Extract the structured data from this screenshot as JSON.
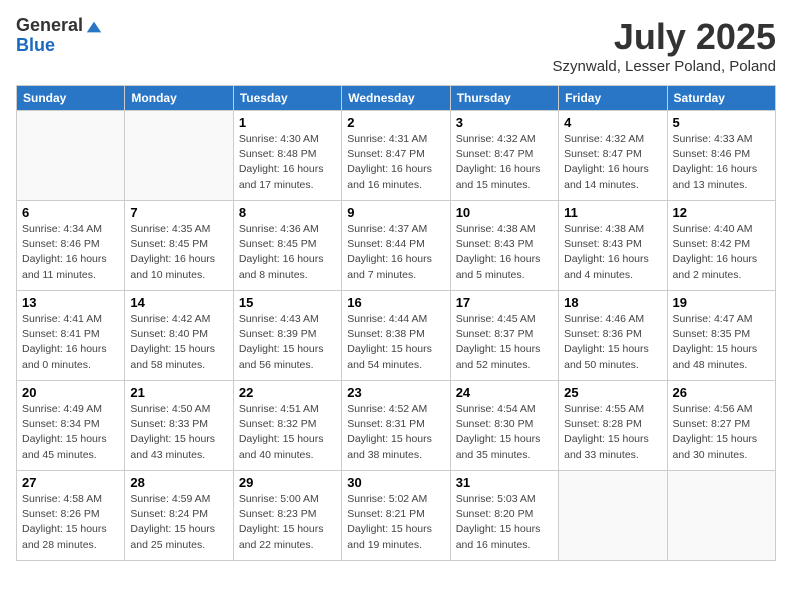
{
  "logo": {
    "general": "General",
    "blue": "Blue"
  },
  "title": "July 2025",
  "location": "Szynwald, Lesser Poland, Poland",
  "days_of_week": [
    "Sunday",
    "Monday",
    "Tuesday",
    "Wednesday",
    "Thursday",
    "Friday",
    "Saturday"
  ],
  "weeks": [
    [
      {
        "day": "",
        "info": ""
      },
      {
        "day": "",
        "info": ""
      },
      {
        "day": "1",
        "info": "Sunrise: 4:30 AM\nSunset: 8:48 PM\nDaylight: 16 hours and 17 minutes."
      },
      {
        "day": "2",
        "info": "Sunrise: 4:31 AM\nSunset: 8:47 PM\nDaylight: 16 hours and 16 minutes."
      },
      {
        "day": "3",
        "info": "Sunrise: 4:32 AM\nSunset: 8:47 PM\nDaylight: 16 hours and 15 minutes."
      },
      {
        "day": "4",
        "info": "Sunrise: 4:32 AM\nSunset: 8:47 PM\nDaylight: 16 hours and 14 minutes."
      },
      {
        "day": "5",
        "info": "Sunrise: 4:33 AM\nSunset: 8:46 PM\nDaylight: 16 hours and 13 minutes."
      }
    ],
    [
      {
        "day": "6",
        "info": "Sunrise: 4:34 AM\nSunset: 8:46 PM\nDaylight: 16 hours and 11 minutes."
      },
      {
        "day": "7",
        "info": "Sunrise: 4:35 AM\nSunset: 8:45 PM\nDaylight: 16 hours and 10 minutes."
      },
      {
        "day": "8",
        "info": "Sunrise: 4:36 AM\nSunset: 8:45 PM\nDaylight: 16 hours and 8 minutes."
      },
      {
        "day": "9",
        "info": "Sunrise: 4:37 AM\nSunset: 8:44 PM\nDaylight: 16 hours and 7 minutes."
      },
      {
        "day": "10",
        "info": "Sunrise: 4:38 AM\nSunset: 8:43 PM\nDaylight: 16 hours and 5 minutes."
      },
      {
        "day": "11",
        "info": "Sunrise: 4:38 AM\nSunset: 8:43 PM\nDaylight: 16 hours and 4 minutes."
      },
      {
        "day": "12",
        "info": "Sunrise: 4:40 AM\nSunset: 8:42 PM\nDaylight: 16 hours and 2 minutes."
      }
    ],
    [
      {
        "day": "13",
        "info": "Sunrise: 4:41 AM\nSunset: 8:41 PM\nDaylight: 16 hours and 0 minutes."
      },
      {
        "day": "14",
        "info": "Sunrise: 4:42 AM\nSunset: 8:40 PM\nDaylight: 15 hours and 58 minutes."
      },
      {
        "day": "15",
        "info": "Sunrise: 4:43 AM\nSunset: 8:39 PM\nDaylight: 15 hours and 56 minutes."
      },
      {
        "day": "16",
        "info": "Sunrise: 4:44 AM\nSunset: 8:38 PM\nDaylight: 15 hours and 54 minutes."
      },
      {
        "day": "17",
        "info": "Sunrise: 4:45 AM\nSunset: 8:37 PM\nDaylight: 15 hours and 52 minutes."
      },
      {
        "day": "18",
        "info": "Sunrise: 4:46 AM\nSunset: 8:36 PM\nDaylight: 15 hours and 50 minutes."
      },
      {
        "day": "19",
        "info": "Sunrise: 4:47 AM\nSunset: 8:35 PM\nDaylight: 15 hours and 48 minutes."
      }
    ],
    [
      {
        "day": "20",
        "info": "Sunrise: 4:49 AM\nSunset: 8:34 PM\nDaylight: 15 hours and 45 minutes."
      },
      {
        "day": "21",
        "info": "Sunrise: 4:50 AM\nSunset: 8:33 PM\nDaylight: 15 hours and 43 minutes."
      },
      {
        "day": "22",
        "info": "Sunrise: 4:51 AM\nSunset: 8:32 PM\nDaylight: 15 hours and 40 minutes."
      },
      {
        "day": "23",
        "info": "Sunrise: 4:52 AM\nSunset: 8:31 PM\nDaylight: 15 hours and 38 minutes."
      },
      {
        "day": "24",
        "info": "Sunrise: 4:54 AM\nSunset: 8:30 PM\nDaylight: 15 hours and 35 minutes."
      },
      {
        "day": "25",
        "info": "Sunrise: 4:55 AM\nSunset: 8:28 PM\nDaylight: 15 hours and 33 minutes."
      },
      {
        "day": "26",
        "info": "Sunrise: 4:56 AM\nSunset: 8:27 PM\nDaylight: 15 hours and 30 minutes."
      }
    ],
    [
      {
        "day": "27",
        "info": "Sunrise: 4:58 AM\nSunset: 8:26 PM\nDaylight: 15 hours and 28 minutes."
      },
      {
        "day": "28",
        "info": "Sunrise: 4:59 AM\nSunset: 8:24 PM\nDaylight: 15 hours and 25 minutes."
      },
      {
        "day": "29",
        "info": "Sunrise: 5:00 AM\nSunset: 8:23 PM\nDaylight: 15 hours and 22 minutes."
      },
      {
        "day": "30",
        "info": "Sunrise: 5:02 AM\nSunset: 8:21 PM\nDaylight: 15 hours and 19 minutes."
      },
      {
        "day": "31",
        "info": "Sunrise: 5:03 AM\nSunset: 8:20 PM\nDaylight: 15 hours and 16 minutes."
      },
      {
        "day": "",
        "info": ""
      },
      {
        "day": "",
        "info": ""
      }
    ]
  ]
}
